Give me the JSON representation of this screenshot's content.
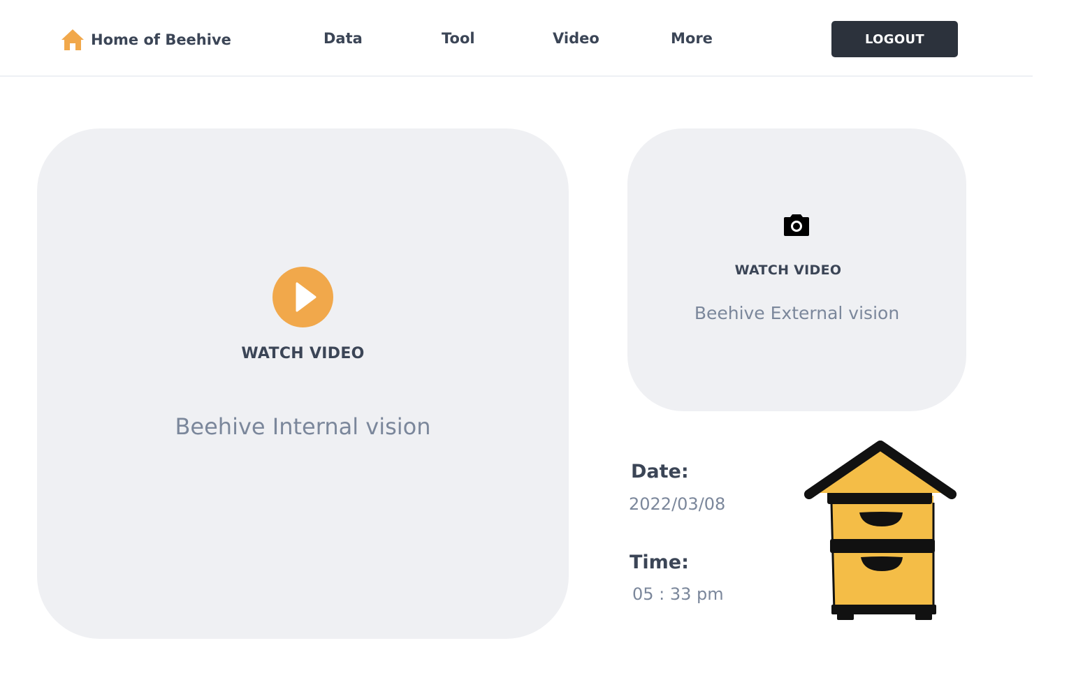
{
  "colors": {
    "accent": "#f1a84b",
    "primary_dark": "#2c323c",
    "card_bg": "#eff0f3",
    "muted_text": "#7b879b",
    "hive_yellow": "#f4bd47"
  },
  "navbar": {
    "brand": {
      "icon": "home-icon",
      "label": "Home of Beehive"
    },
    "links": [
      {
        "label": "Data"
      },
      {
        "label": "Tool"
      },
      {
        "label": "Video"
      },
      {
        "label": "More"
      }
    ],
    "logout_label": "LOGOUT"
  },
  "internal_card": {
    "icon": "play-icon",
    "action_label": "WATCH VIDEO",
    "title": "Beehive Internal vision"
  },
  "external_card": {
    "icon": "camera-icon",
    "action_label": "WATCH VIDEO",
    "title": "Beehive External vision"
  },
  "info": {
    "date_label": "Date:",
    "date_value": "2022/03/08",
    "time_label": "Time:",
    "time_value": "05 : 33 pm"
  },
  "illustration": {
    "icon": "beehive-icon"
  }
}
